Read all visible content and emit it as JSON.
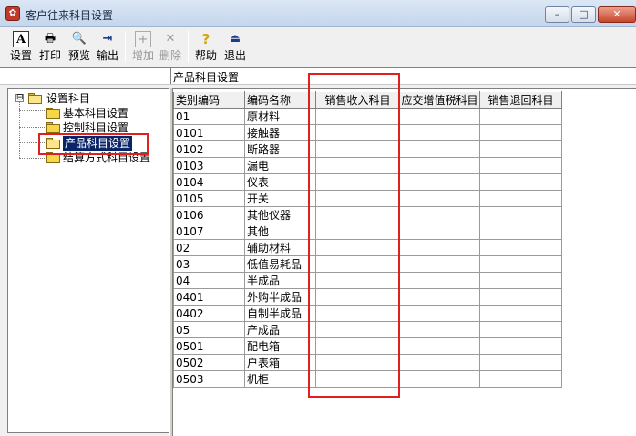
{
  "window": {
    "title": "客户往来科目设置",
    "controls": {
      "minimize": "–",
      "maximize": "□",
      "close": "✕"
    }
  },
  "toolbar": [
    {
      "id": "setup",
      "label": "设置",
      "icon": "A",
      "icon_name": "setup-icon",
      "enabled": true
    },
    {
      "id": "print",
      "label": "打印",
      "icon": "🖶",
      "icon_name": "printer-icon",
      "enabled": true
    },
    {
      "id": "preview",
      "label": "预览",
      "icon": "🔍",
      "icon_name": "preview-icon",
      "enabled": true
    },
    {
      "id": "export",
      "label": "输出",
      "icon": "⇥",
      "icon_name": "export-icon",
      "enabled": true
    },
    {
      "id": "add",
      "label": "增加",
      "icon": "+",
      "icon_name": "add-icon",
      "enabled": false
    },
    {
      "id": "delete",
      "label": "删除",
      "icon": "✕",
      "icon_name": "delete-icon",
      "enabled": false
    },
    {
      "id": "help",
      "label": "帮助",
      "icon": "?",
      "icon_name": "help-icon",
      "enabled": true
    },
    {
      "id": "exit",
      "label": "退出",
      "icon": "⏏",
      "icon_name": "exit-icon",
      "enabled": true
    }
  ],
  "location": {
    "text": "产品科目设置"
  },
  "tree": {
    "root": {
      "label": "设置科目",
      "expander": "⊟"
    },
    "children": [
      {
        "label": "基本科目设置"
      },
      {
        "label": "控制科目设置"
      },
      {
        "label": "产品科目设置",
        "selected": true
      },
      {
        "label": "结算方式科目设置"
      }
    ]
  },
  "grid": {
    "columns": [
      "类别编码",
      "编码名称",
      "销售收入科目",
      "应交增值税科目",
      "销售退回科目"
    ],
    "rows": [
      [
        "01",
        "原材料",
        "",
        "",
        ""
      ],
      [
        "0101",
        "接触器",
        "",
        "",
        ""
      ],
      [
        "0102",
        "断路器",
        "",
        "",
        ""
      ],
      [
        "0103",
        "漏电",
        "",
        "",
        ""
      ],
      [
        "0104",
        "仪表",
        "",
        "",
        ""
      ],
      [
        "0105",
        "开关",
        "",
        "",
        ""
      ],
      [
        "0106",
        "其他仪器",
        "",
        "",
        ""
      ],
      [
        "0107",
        "其他",
        "",
        "",
        ""
      ],
      [
        "02",
        "辅助材料",
        "",
        "",
        ""
      ],
      [
        "03",
        "低值易耗品",
        "",
        "",
        ""
      ],
      [
        "04",
        "半成品",
        "",
        "",
        ""
      ],
      [
        "0401",
        "外购半成品",
        "",
        "",
        ""
      ],
      [
        "0402",
        "自制半成品",
        "",
        "",
        ""
      ],
      [
        "05",
        "产成品",
        "",
        "",
        ""
      ],
      [
        "0501",
        "配电箱",
        "",
        "",
        ""
      ],
      [
        "0502",
        "户表箱",
        "",
        "",
        ""
      ],
      [
        "0503",
        "机柜",
        "",
        "",
        ""
      ]
    ]
  },
  "colors": {
    "highlight": "#e02020",
    "selection": "#0a246a"
  }
}
